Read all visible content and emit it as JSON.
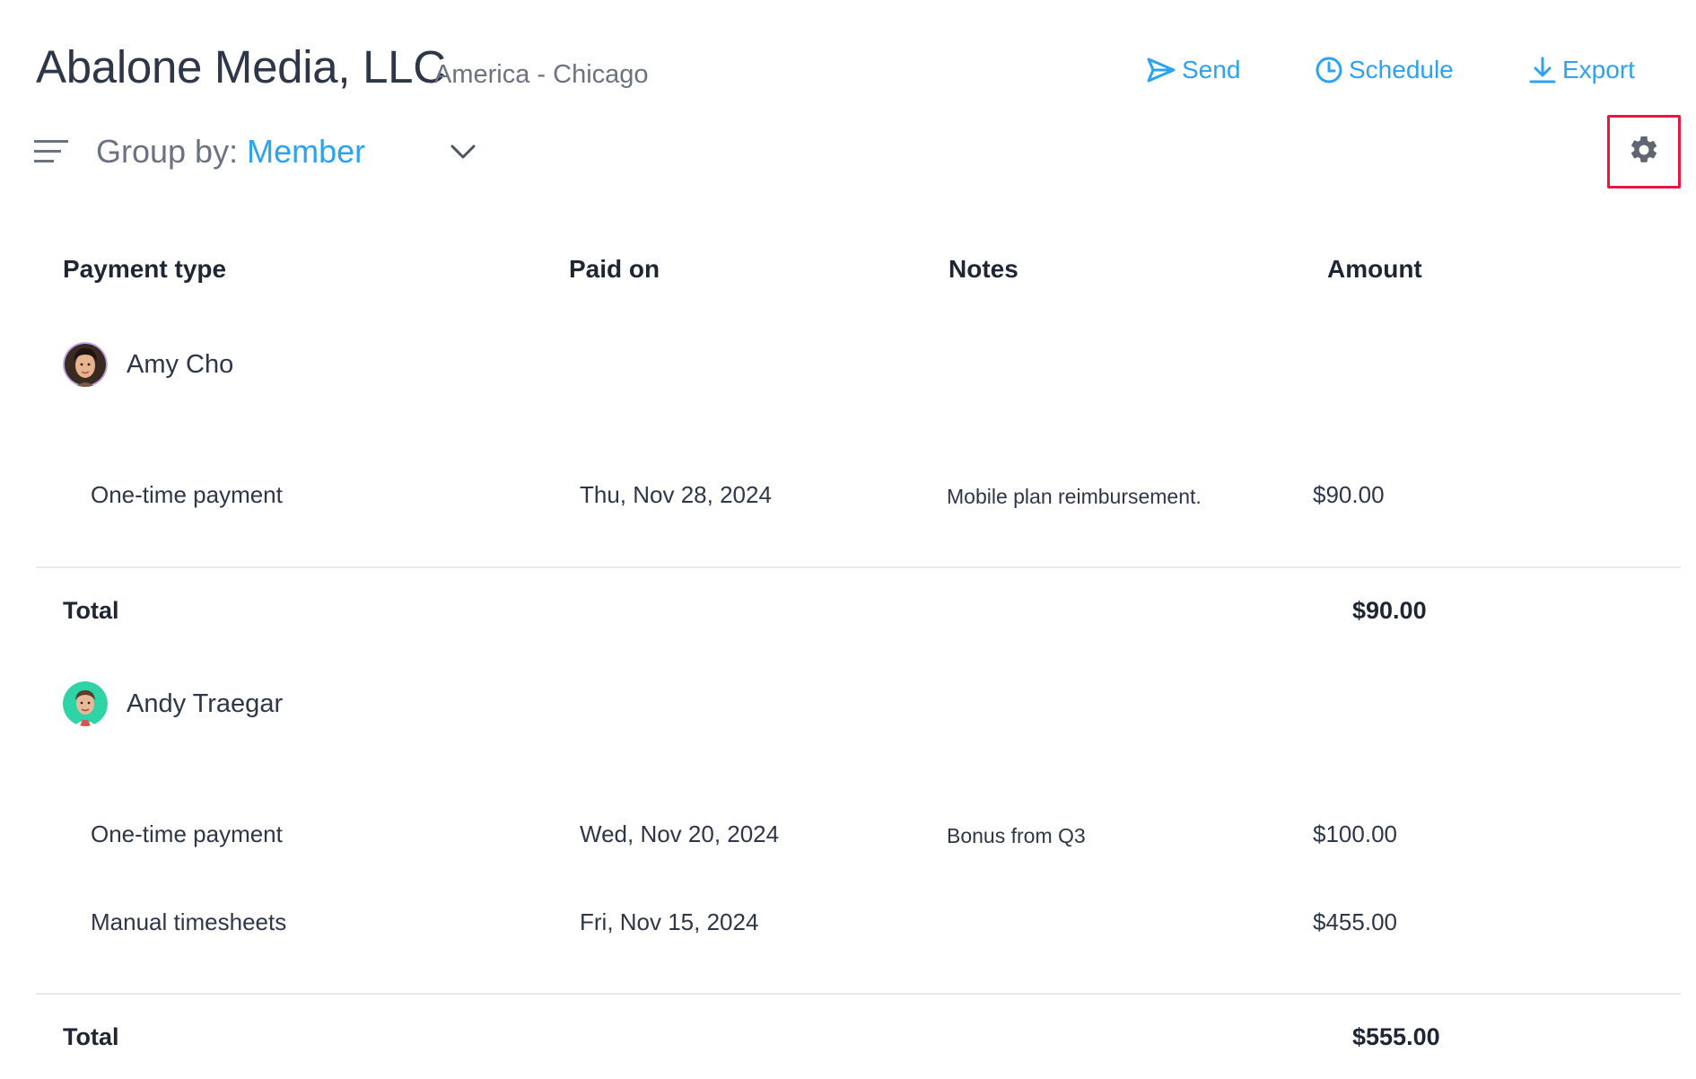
{
  "header": {
    "company_name": "Abalone Media, LLC",
    "location": "America - Chicago",
    "actions": {
      "send": "Send",
      "schedule": "Schedule",
      "export": "Export"
    }
  },
  "toolbar": {
    "group_by_label": "Group by:",
    "group_by_value": "Member",
    "settings_icon": "gear-icon"
  },
  "table": {
    "columns": [
      "Payment type",
      "Paid on",
      "Notes",
      "Amount"
    ],
    "groups": [
      {
        "member": "Amy Cho",
        "rows": [
          {
            "payment_type": "One-time payment",
            "paid_on": "Thu, Nov 28, 2024",
            "notes": "Mobile plan reimbursement.",
            "amount": "$90.00"
          }
        ],
        "total_label": "Total",
        "total_amount": "$90.00"
      },
      {
        "member": "Andy Traegar",
        "rows": [
          {
            "payment_type": "One-time payment",
            "paid_on": "Wed, Nov 20, 2024",
            "notes": "Bonus from Q3",
            "amount": "$100.00"
          },
          {
            "payment_type": "Manual timesheets",
            "paid_on": "Fri, Nov 15, 2024",
            "notes": "",
            "amount": "$455.00"
          }
        ],
        "total_label": "Total",
        "total_amount": "$555.00"
      }
    ]
  },
  "colors": {
    "accent": "#2ba3f2",
    "highlight_border": "#e8173b",
    "text_primary": "#2d3748",
    "text_muted": "#6b7280"
  }
}
